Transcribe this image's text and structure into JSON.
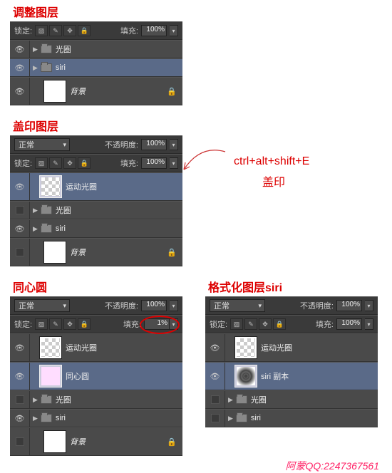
{
  "sections": {
    "s1": {
      "title": "调整图层"
    },
    "s2": {
      "title": "盖印图层"
    },
    "s3": {
      "title": "同心圆"
    },
    "s4": {
      "title": "格式化图层siri"
    }
  },
  "common": {
    "lock_label": "锁定:",
    "fill_label": "填充:",
    "opacity_label": "不透明度:",
    "blend_normal": "正常",
    "pct100": "100%",
    "pct1": "1%"
  },
  "layers": {
    "aperture": "光圈",
    "siri": "siri",
    "bg": "背景",
    "motion": "运动光圈",
    "concentric": "同心圆",
    "siri_copy": "siri 副本"
  },
  "annotation": {
    "shortcut": "ctrl+alt+shift+E",
    "stamp": "盖印"
  },
  "credit": "阿蒙QQ:2247367561"
}
